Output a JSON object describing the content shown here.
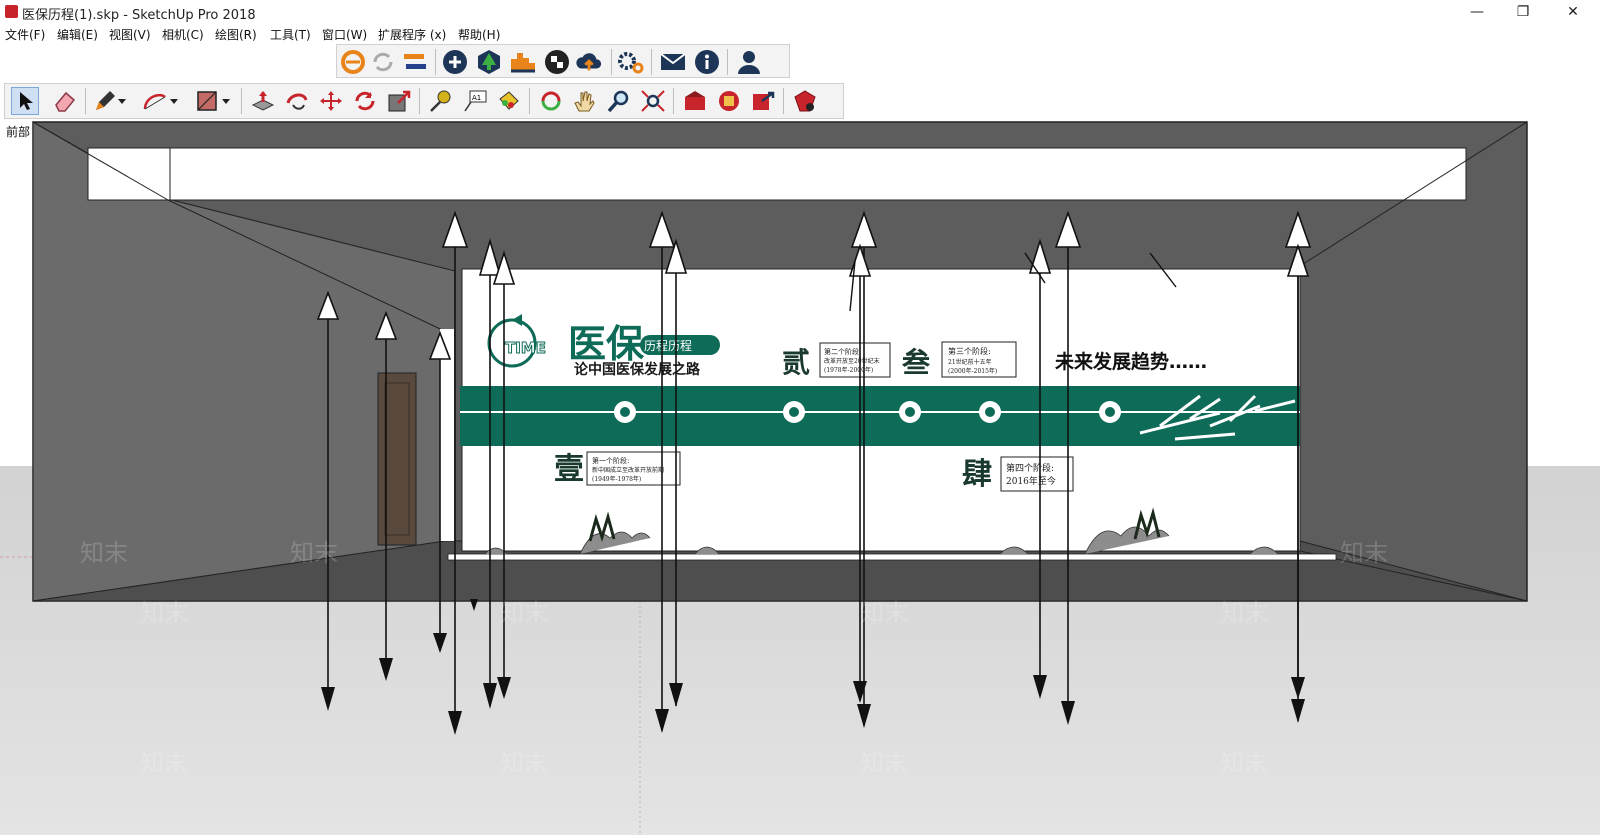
{
  "window": {
    "title": "医保历程(1).skp - SketchUp Pro 2018"
  },
  "window_controls": {
    "minimize": "—",
    "maximize": "❐",
    "close": "✕"
  },
  "menu": [
    "文件(F)",
    "编辑(E)",
    "视图(V)",
    "相机(C)",
    "绘图(R)",
    "工具(T)",
    "窗口(W)",
    "扩展程序 (x)",
    "帮助(H)"
  ],
  "scene": {
    "label": "前部"
  },
  "wall": {
    "logo_word": "TIME",
    "title": "医保",
    "title_badges": "历程历程",
    "subtitle": "论中国医保发展之路",
    "future": "未来发展趋势……",
    "stage1": {
      "numeral": "壹",
      "line1": "第一个阶段:",
      "line2": "新中国成立至改革开放前期",
      "line3": "(1949年-1978年)"
    },
    "stage2": {
      "numeral": "贰",
      "line1": "第二个阶段:",
      "line2": "改革开放至20世纪末",
      "line3": "(1978年-2000年)"
    },
    "stage3": {
      "numeral": "叁",
      "line1": "第三个阶段:",
      "line2": "21世纪前十五年",
      "line3": "(2000年-2015年)"
    },
    "stage4": {
      "numeral": "肆",
      "line1": "第四个阶段:",
      "line2": "2016年至今"
    }
  },
  "watermark": "知末",
  "colors": {
    "accent_green": "#0e6b57",
    "room_gray": "#5d5d5d",
    "ceiling_white": "#ffffff"
  }
}
